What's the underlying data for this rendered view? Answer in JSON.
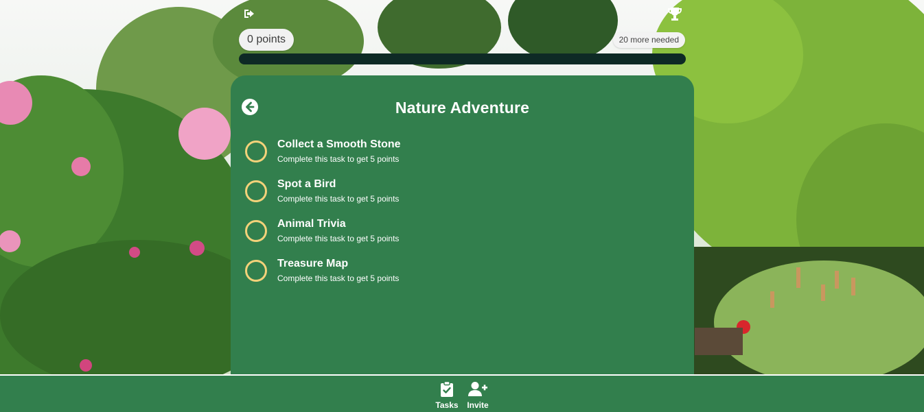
{
  "header": {
    "points_label": "0 points",
    "needed_label": "20 more needed",
    "progress_fraction": 0
  },
  "card": {
    "title": "Nature Adventure",
    "tasks": [
      {
        "name": "Collect a Smooth Stone",
        "description": "Complete this task to get 5 points"
      },
      {
        "name": "Spot a Bird",
        "description": "Complete this task to get 5 points"
      },
      {
        "name": "Animal Trivia",
        "description": "Complete this task to get 5 points"
      },
      {
        "name": "Treasure Map",
        "description": "Complete this task to get 5 points"
      }
    ]
  },
  "nav": {
    "tasks_label": "Tasks",
    "invite_label": "Invite"
  },
  "colors": {
    "card_green": "#327f4d",
    "checkbox_ring": "#f4d27a",
    "progress_track": "#0e2a25"
  },
  "icons": [
    "logout-icon",
    "trophy-icon",
    "arrow-left-circle-icon",
    "clipboard-check-icon",
    "user-plus-icon"
  ]
}
